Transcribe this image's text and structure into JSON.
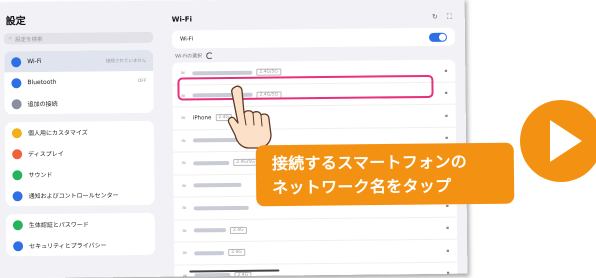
{
  "sidebar": {
    "title": "設定",
    "search_placeholder": "設定を検索",
    "group1": [
      {
        "label": "Wi-Fi",
        "value": "接続されていません",
        "icon": "wifi-icon",
        "color": "#2f6fe4"
      },
      {
        "label": "Bluetooth",
        "value": "OFF",
        "icon": "bluetooth-icon",
        "color": "#2f6fe4"
      },
      {
        "label": "追加の接続",
        "value": "",
        "icon": "more-icon",
        "color": "#8a8f9e"
      }
    ],
    "group2": [
      {
        "label": "個人用にカスタマイズ",
        "icon": "palette-icon",
        "color": "#f1b11b"
      },
      {
        "label": "ディスプレイ",
        "icon": "display-icon",
        "color": "#f0603c"
      },
      {
        "label": "サウンド",
        "icon": "sound-icon",
        "color": "#27b35d"
      },
      {
        "label": "通知およびコントロールセンター",
        "icon": "notification-icon",
        "color": "#2f6fe4"
      }
    ],
    "group3": [
      {
        "label": "生体認証とパスワード",
        "icon": "lock-icon",
        "color": "#27b35d"
      },
      {
        "label": "セキュリティとプライバシー",
        "icon": "shield-icon",
        "color": "#2f6fe4"
      }
    ]
  },
  "panel": {
    "title": "Wi-Fi",
    "wifi_toggle_label": "Wi-Fi",
    "wifi_on": true,
    "section_label": "Wi-Fiの選択",
    "networks": [
      {
        "ssid_blur": 60,
        "name": "",
        "band": "2.4G/5G"
      },
      {
        "ssid_blur": 60,
        "name": "",
        "band": "2.4G/5G"
      },
      {
        "ssid_blur": 0,
        "name": "iPhone",
        "band": "2.4G"
      },
      {
        "ssid_blur": 55,
        "name": "",
        "band": ""
      },
      {
        "ssid_blur": 36,
        "name": "",
        "band": "2.4G/5G"
      },
      {
        "ssid_blur": 48,
        "name": "",
        "band": ""
      },
      {
        "ssid_blur": 55,
        "name": "",
        "band": ""
      },
      {
        "ssid_blur": 32,
        "name": "",
        "band": "2.4G"
      },
      {
        "ssid_blur": 30,
        "name": "",
        "band": "2.4G"
      },
      {
        "ssid_blur": 36,
        "name": "",
        "band": "2.4G"
      }
    ]
  },
  "callout": {
    "line1": "接続するスマートフォンの",
    "line2": "ネットワーク名をタップ"
  }
}
